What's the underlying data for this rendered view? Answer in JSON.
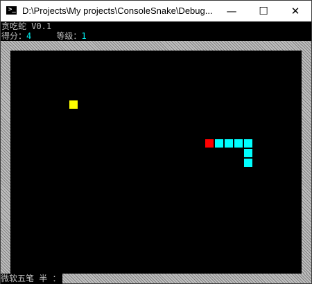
{
  "window": {
    "title": "D:\\Projects\\My projects\\ConsoleSnake\\Debug...",
    "controls": {
      "minimize": "—",
      "maximize": "☐",
      "close": "✕"
    }
  },
  "console": {
    "app_title": "贪吃蛇 V0.1",
    "score_label": "得分：",
    "score_value": "4",
    "level_label": "等级：",
    "level_value": "1",
    "ime_status": "微软五笔 半 ："
  },
  "game": {
    "food_color": "#ffff00",
    "head_color": "#ff0000",
    "body_color": "#00ffff",
    "wall_color": "#c0c0c0"
  }
}
